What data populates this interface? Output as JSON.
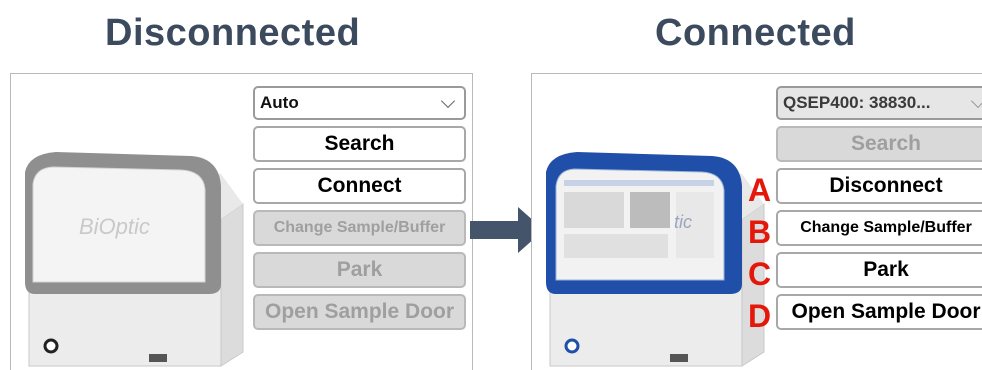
{
  "headings": {
    "left": "Disconnected",
    "right": "Connected"
  },
  "disconnected": {
    "port_select": {
      "value": "Auto"
    },
    "buttons": {
      "search": "Search",
      "connect": "Connect",
      "change_sample_buffer": "Change Sample/Buffer",
      "park": "Park",
      "open_sample_door": "Open Sample Door"
    },
    "instrument": {
      "brand_text": "BiOptic",
      "lid_color": "#8f8f8f"
    }
  },
  "connected": {
    "port_select": {
      "value": "QSEP400: 38830..."
    },
    "buttons": {
      "search": "Search",
      "disconnect": "Disconnect",
      "change_sample_buffer": "Change Sample/Buffer",
      "park": "Park",
      "open_sample_door": "Open Sample Door"
    },
    "markers": [
      "A",
      "B",
      "C",
      "D"
    ],
    "instrument": {
      "brand_text": "tic",
      "lid_color": "#1f4fa8"
    }
  },
  "colors": {
    "heading": "#3c4a5e",
    "marker": "#e3170a",
    "arrow": "#44546a",
    "disabled_fill": "#d9d9d9",
    "disabled_text": "#9f9f9f"
  }
}
